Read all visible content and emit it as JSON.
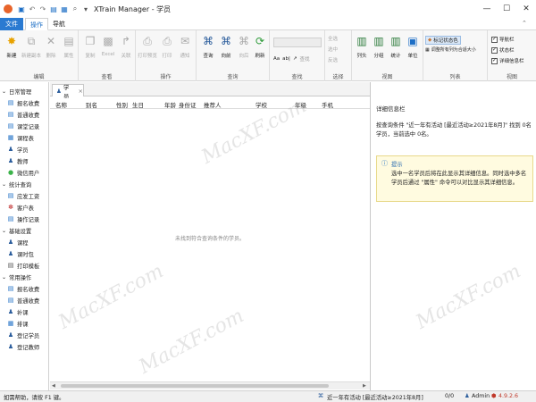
{
  "window": {
    "title": "XTrain Manager - 学员"
  },
  "menu": {
    "tabs": [
      "文件",
      "操作",
      "导航"
    ],
    "active": "操作"
  },
  "ribbon": {
    "groups": [
      {
        "name": "编辑",
        "buttons": [
          "新建",
          "新建副本",
          "删除",
          "属性"
        ]
      },
      {
        "name": "查看",
        "buttons": [
          "复制",
          "Excel",
          "关联"
        ]
      },
      {
        "name": "操作",
        "buttons": [
          "打印预览",
          "打印",
          "通知"
        ]
      },
      {
        "name": "查询",
        "buttons": [
          "查询",
          "向前",
          "向后",
          "刷新"
        ]
      },
      {
        "name": "查找",
        "buttons": [
          "Aa",
          "ab|",
          "↗",
          "查找"
        ]
      },
      {
        "name": "选择",
        "buttons": [
          "全选",
          "选中",
          "反选"
        ]
      },
      {
        "name": "视图",
        "buttons": [
          "列头",
          "分组",
          "统计",
          "单位"
        ]
      },
      {
        "name": "列表",
        "buttons": [
          "标记状态色",
          "调整所有列为合适大小"
        ]
      },
      {
        "name": "视图",
        "buttons": [
          "导航栏",
          "状态栏",
          "详细信息栏"
        ]
      }
    ]
  },
  "sidebar": {
    "groups": [
      {
        "label": "日常管理",
        "items": [
          "报名收费",
          "普通收费",
          "课堂记录",
          "课程表",
          "学员",
          "教师",
          "微信用户"
        ]
      },
      {
        "label": "统计查询",
        "items": [
          "应发工资",
          "客户表",
          "操作记录"
        ]
      },
      {
        "label": "基础设置",
        "items": [
          "课程",
          "课时包",
          "打印模板"
        ]
      },
      {
        "label": "常用操作",
        "items": [
          "报名收费",
          "普通收费",
          "补课",
          "排课",
          "登记学员",
          "登记教师"
        ]
      }
    ]
  },
  "doc_tab": {
    "label": "学员",
    "close": "×"
  },
  "grid": {
    "columns": [
      "名称",
      "别名",
      "性别",
      "生日",
      "年龄",
      "身份证",
      "推荐人",
      "学校",
      "年级",
      "手机"
    ],
    "empty_message": "未找到符合查询条件的学员。"
  },
  "detail": {
    "title": "详细信息栏",
    "text": "按查询条件 \"近一年有活动 [最近活动≥2021年8月]\" 找到 0名学员，当前选中 0名。",
    "hint_title": "提示",
    "hint_body": "选中一名学员后将在此显示其详细信息。同时选中多名学员后通过 \"属性\" 命令可以对比显示其详细信息。"
  },
  "status": {
    "left": "如需帮助，请按 F1 键。",
    "filter": "近一年有活动 [最近活动≥2021年8月]",
    "count": "0/0",
    "user": "Admin",
    "version": "4.9.2.6"
  },
  "watermark": "MacXF.com",
  "colors": {
    "accent": "#1e6fc6",
    "tab_active_bg": "#2a7ad1"
  }
}
